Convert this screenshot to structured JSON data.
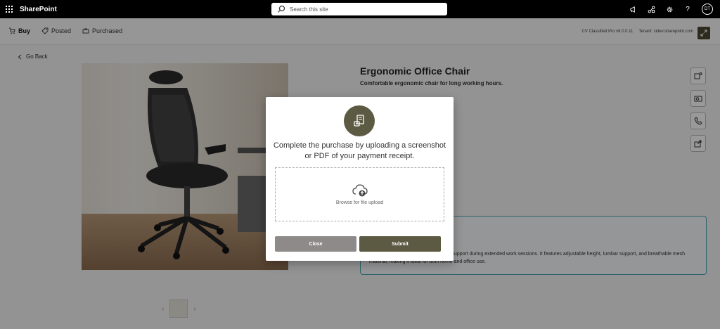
{
  "suite": {
    "brand": "SharePoint",
    "search_placeholder": "Search this site",
    "avatar_initials": "DT"
  },
  "appbar": {
    "tabs": [
      {
        "label": "Buy",
        "icon": "cart-icon",
        "active": true
      },
      {
        "label": "Posted",
        "icon": "tag-icon",
        "active": false
      },
      {
        "label": "Purchased",
        "icon": "bag-icon",
        "active": false
      }
    ],
    "version": "CV Classified Pro v8.0.0.11",
    "tenant": "Tenant: cidev.sharepoint.com"
  },
  "product": {
    "go_back": "Go Back",
    "title": "Ergonomic Office Chair",
    "subtitle": "Comfortable ergonomic chair for long working hours.",
    "description": "ned to provide maximum comfort and support during extended work sessions. It features adjustable height, lumbar support, and breathable mesh material, making it ideal for both home and office use."
  },
  "modal": {
    "icon": "receipt-icon",
    "message": "Complete the purchase by uploading a screenshot or PDF of your payment receipt.",
    "upload_label": "Browse for file upload",
    "close_label": "Close",
    "submit_label": "Submit"
  },
  "colors": {
    "accent": "#5c5a43",
    "close_button": "#8f8a8a",
    "suitebar": "#000000"
  }
}
